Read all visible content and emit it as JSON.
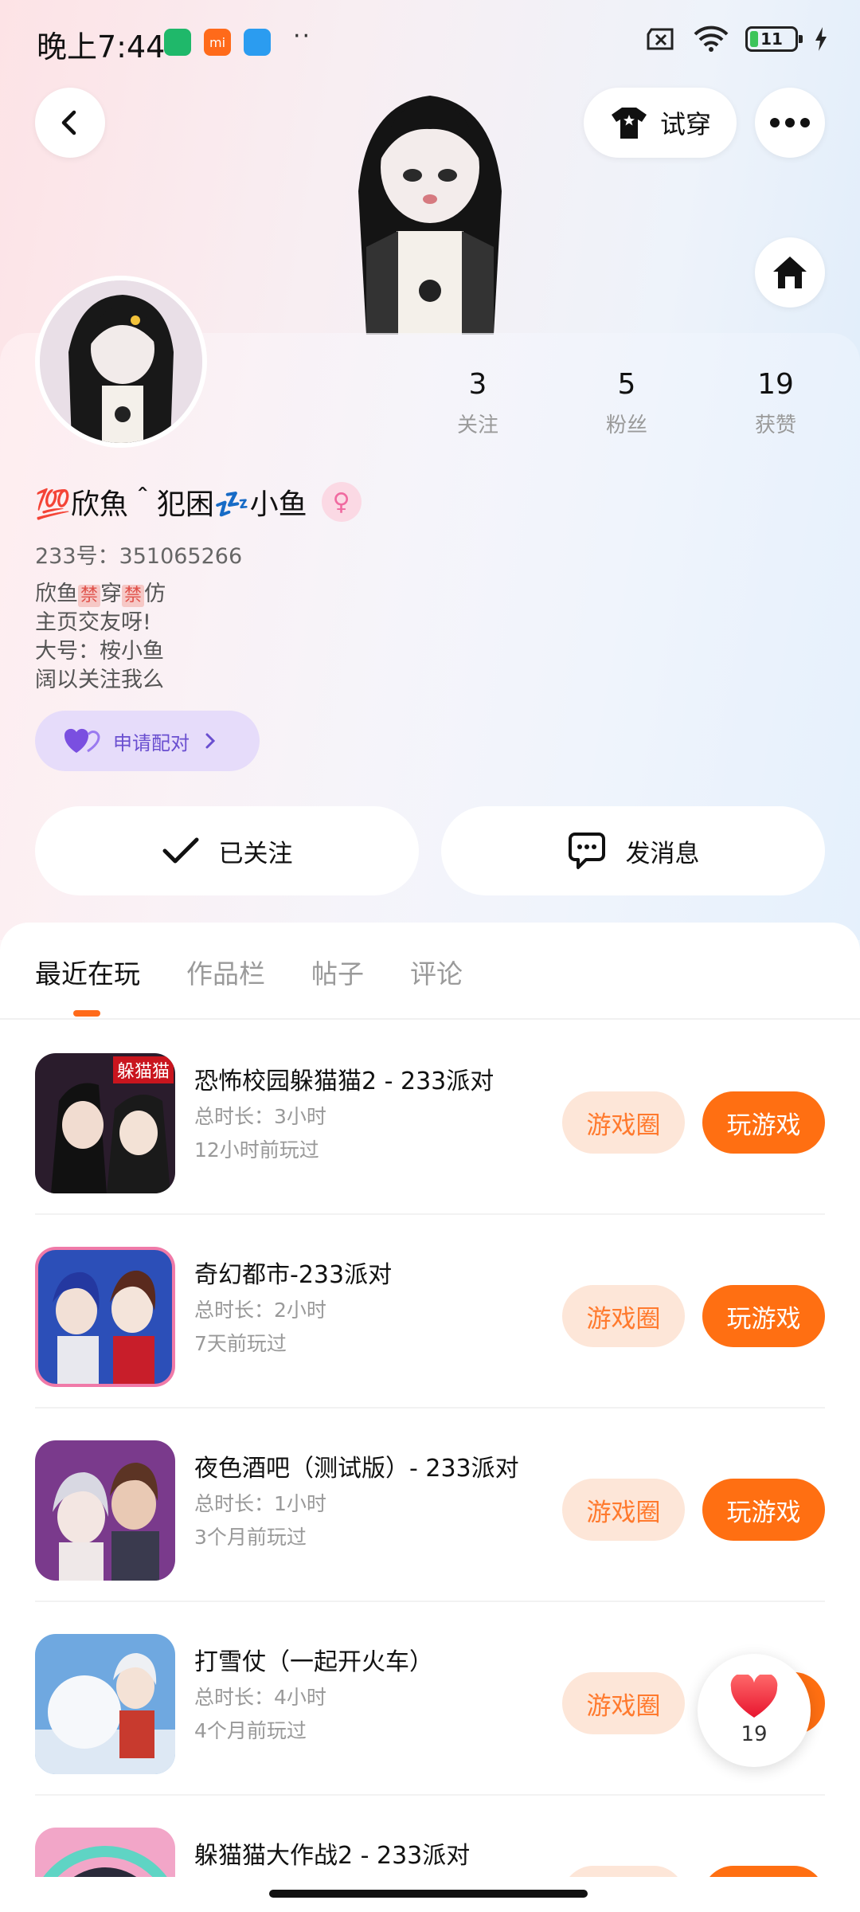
{
  "status_bar": {
    "time": "晚上7:44",
    "battery": "11",
    "dots": "··"
  },
  "header": {
    "try_on_label": "试穿"
  },
  "profile": {
    "stats": [
      {
        "value": "3",
        "label": "关注"
      },
      {
        "value": "5",
        "label": "粉丝"
      },
      {
        "value": "19",
        "label": "获赞"
      }
    ],
    "username": "💯欣魚＾犯困💤小鱼",
    "gender_symbol": "♀",
    "uid": "233号：351065266",
    "bio": {
      "line1_a": "欣鱼",
      "line1_tag1": "禁",
      "line1_b": "穿",
      "line1_tag2": "禁",
      "line1_c": "仿",
      "line2": "主页交友呀!",
      "line3": "大号：桉小鱼",
      "line4": "阔以关注我么"
    },
    "pair_label": "申请配对",
    "follow_label": "已关注",
    "message_label": "发消息"
  },
  "tabs": [
    {
      "label": "最近在玩",
      "active": true
    },
    {
      "label": "作品栏",
      "active": false
    },
    {
      "label": "帖子",
      "active": false
    },
    {
      "label": "评论",
      "active": false
    }
  ],
  "games": [
    {
      "name": "恐怖校园躲猫猫2 - 233派对",
      "duration": "总时长：3小时",
      "last_played": "12小时前玩过",
      "icon_text": "躲猫猫"
    },
    {
      "name": "奇幻都市-233派对",
      "duration": "总时长：2小时",
      "last_played": "7天前玩过",
      "icon_text": ""
    },
    {
      "name": "夜色酒吧（测试版）- 233派对",
      "duration": "总时长：1小时",
      "last_played": "3个月前玩过",
      "icon_text": ""
    },
    {
      "name": "打雪仗（一起开火车）",
      "duration": "总时长：4小时",
      "last_played": "4个月前玩过",
      "icon_text": ""
    },
    {
      "name": "躲猫猫大作战2 - 233派对",
      "duration": "",
      "last_played": "",
      "icon_text": ""
    }
  ],
  "game_actions": {
    "circle_label": "游戏圈",
    "play_label": "玩游戏"
  },
  "like_float": {
    "count": "19"
  },
  "colors": {
    "accent": "#ff6f12",
    "accent_soft": "#fde6d8",
    "pair_bg": "#e6dcfa",
    "pair_text": "#6a4fd0"
  }
}
